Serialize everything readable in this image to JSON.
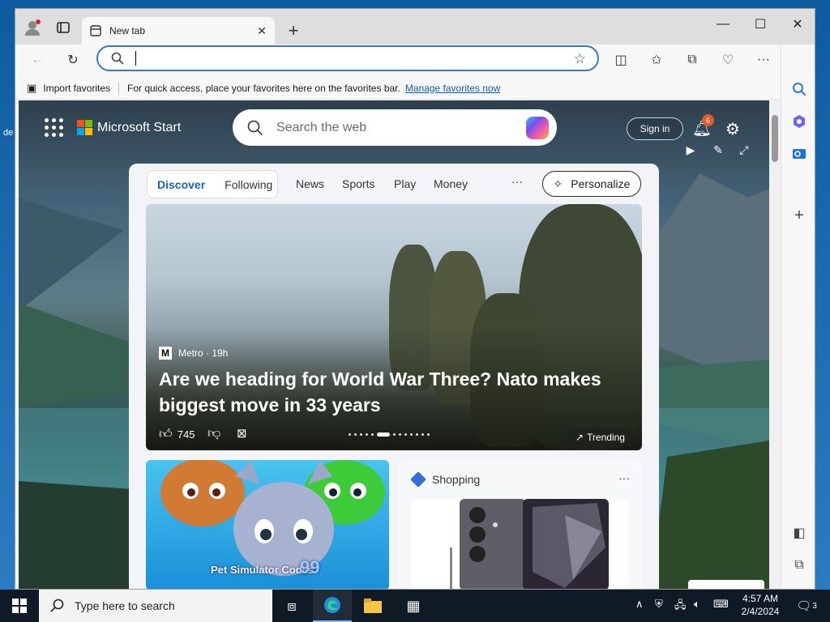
{
  "desktop": {
    "edge_label": "de"
  },
  "browser": {
    "tab_label": "New tab",
    "address_value": "",
    "favorites_bar": {
      "import_label": "Import favorites",
      "message": "For quick access, place your favorites here on the favorites bar.",
      "manage_link": "Manage favorites now"
    }
  },
  "start": {
    "brand": "Microsoft Start",
    "search_placeholder": "Search the web",
    "signin": "Sign in",
    "notification_count": "6",
    "tabs": [
      "Discover",
      "Following"
    ],
    "links": [
      "News",
      "Sports",
      "Play",
      "Money"
    ],
    "more": "···",
    "personalize": "Personalize",
    "hero": {
      "source": "Metro · 19h",
      "headline": "Are we heading for World War Three? Nato makes biggest move in 33 years",
      "likes": "745",
      "trending": "Trending"
    },
    "game": {
      "title": "Pet Simulator Codes",
      "number": "99"
    },
    "shopping": {
      "title": "Shopping",
      "more": "···"
    }
  },
  "taskbar": {
    "search_placeholder": "Type here to search",
    "time": "4:57 AM",
    "date": "2/4/2024",
    "notif_count": "3"
  },
  "colors": {
    "accent": "#1464c0",
    "link": "#0f5fb7",
    "taskbar": "#101a26"
  }
}
